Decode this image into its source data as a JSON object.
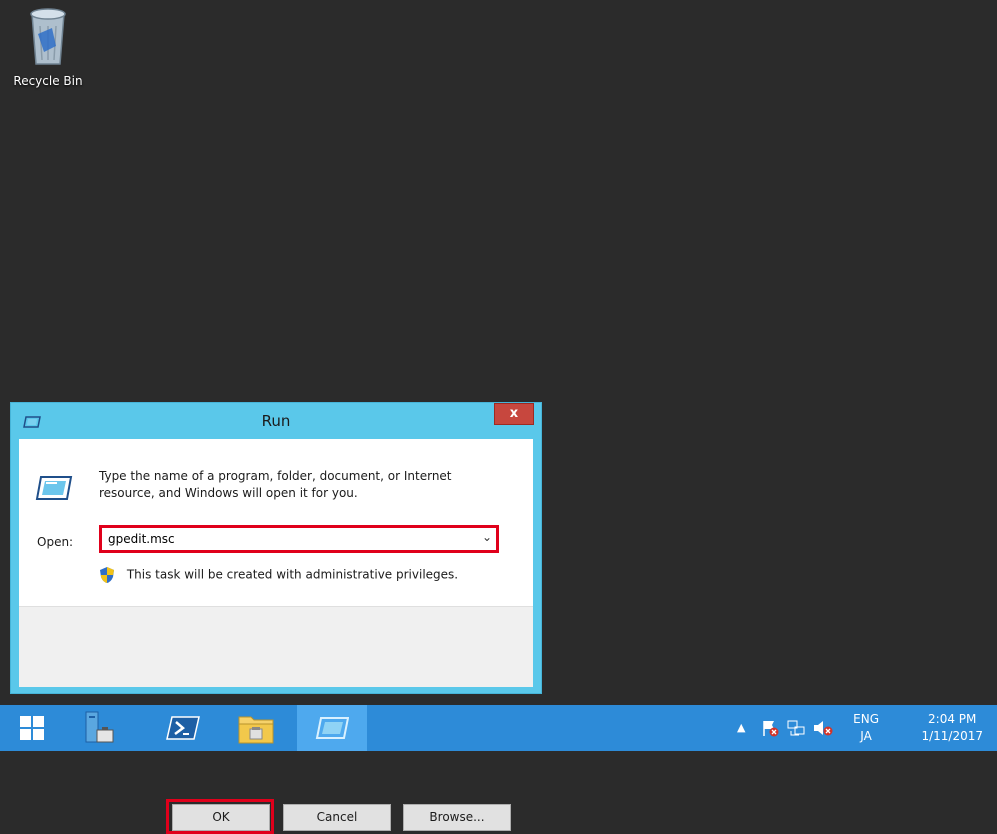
{
  "desktop": {
    "icons": [
      {
        "label": "Recycle Bin",
        "icon": "recycle-bin-icon"
      }
    ]
  },
  "run_dialog": {
    "title": "Run",
    "close_label": "x",
    "description": "Type the name of a program, folder, document, or Internet resource, and Windows will open it for you.",
    "open_label": "Open:",
    "open_value": "gpedit.msc",
    "admin_note": "This task will be created with administrative privileges.",
    "buttons": {
      "ok": "OK",
      "cancel": "Cancel",
      "browse": "Browse..."
    }
  },
  "taskbar": {
    "items": [
      "start-icon",
      "server-manager-icon",
      "powershell-icon",
      "file-explorer-icon",
      "run-icon"
    ],
    "active_item": "run-icon",
    "tray": {
      "icons": [
        "show-hidden-icons-arrow",
        "action-center-icon",
        "network-icon",
        "volume-muted-icon"
      ],
      "lang_top": "ENG",
      "lang_bottom": "JA",
      "time": "2:04 PM",
      "date": "1/11/2017"
    }
  },
  "colors": {
    "desktop_bg": "#2b2b2b",
    "taskbar_bg": "#2d8bd8",
    "window_frame": "#5ac8ea",
    "highlight": "#e0001b"
  }
}
